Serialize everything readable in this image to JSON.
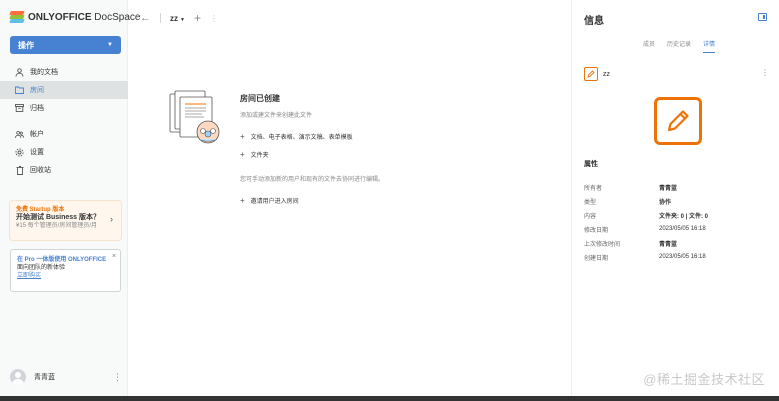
{
  "brand": {
    "name_bold": "ONLYOFFICE",
    "name_rest": " DocSpace"
  },
  "sidebar": {
    "action_label": "操作",
    "items": [
      {
        "label": "我的文档",
        "icon": "person-icon",
        "active": false
      },
      {
        "label": "房间",
        "icon": "folder-icon",
        "active": true
      },
      {
        "label": "归档",
        "icon": "archive-icon",
        "active": false
      },
      {
        "label": "帐户",
        "icon": "accounts-icon",
        "active": false
      },
      {
        "label": "设置",
        "icon": "gear-icon",
        "active": false
      },
      {
        "label": "回收站",
        "icon": "trash-icon",
        "active": false
      }
    ],
    "promo": {
      "line1": "免费 Startup 版本",
      "line2": "开始测试 Business 版本？",
      "line3": "¥15 每个管理员/房间管理员/月"
    },
    "pro_banner": {
      "line1": "在 Pro 一体版使用 ONLYOFFICE",
      "line2": "面向团队的新体验",
      "line3": "立即购买"
    },
    "user_name": "青青蓝"
  },
  "header": {
    "room_title": "zz"
  },
  "empty_state": {
    "title": "房间已创建",
    "description": "添加或建文件来创建此文件",
    "link_files": "文档、电子表格、演示文稿、表单模板",
    "link_folder": "文件夹",
    "note": "您可手动添加新的用户和现有的文件去协同进行编辑。",
    "link_invite": "邀请用户进入房间"
  },
  "info_panel": {
    "title": "信息",
    "tabs": [
      "成员",
      "历史记录",
      "详情"
    ],
    "active_tab": "详情",
    "room_name": "zz",
    "properties_title": "属性",
    "properties": [
      {
        "key": "所有者",
        "value": "青青蓝",
        "bold": true
      },
      {
        "key": "类型",
        "value": "协作",
        "bold": true
      },
      {
        "key": "内容",
        "value": "文件夹: 0 | 文件: 0",
        "bold": true
      },
      {
        "key": "修改日期",
        "value": "2023/05/05 16:18",
        "bold": false
      },
      {
        "key": "上次修改时间",
        "value": "青青蓝",
        "bold": true
      },
      {
        "key": "创建日期",
        "value": "2023/05/05 16:18",
        "bold": false
      }
    ]
  },
  "watermark": "@稀土掘金技术社区",
  "colors": {
    "accent": "#4781d1",
    "room_orange": "#ed7309",
    "sidebar_bg": "#f8f9f9"
  }
}
